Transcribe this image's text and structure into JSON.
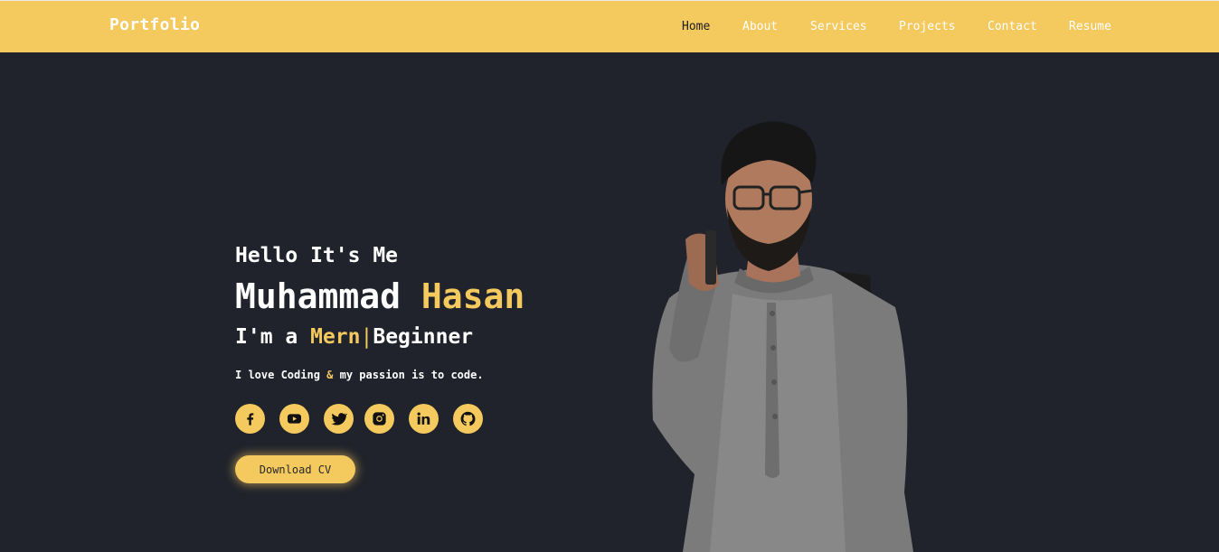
{
  "brand": {
    "logo": "Portfolio"
  },
  "nav": {
    "items": [
      {
        "label": "Home",
        "active": true
      },
      {
        "label": "About",
        "active": false
      },
      {
        "label": "Services",
        "active": false
      },
      {
        "label": "Projects",
        "active": false
      },
      {
        "label": "Contact",
        "active": false
      },
      {
        "label": "Resume",
        "active": false
      }
    ]
  },
  "hero": {
    "greeting": "Hello It's Me",
    "name_first": "Muhammad",
    "name_last": "Hasan",
    "role_prefix": "I'm a",
    "role_highlight": "Mern",
    "role_cursor": "|",
    "role_rest": "Beginner",
    "tagline_part1": "I love Coding",
    "tagline_amp": "&",
    "tagline_part2": "my passion is to code.",
    "socials": [
      {
        "icon": "facebook-icon"
      },
      {
        "icon": "youtube-icon"
      },
      {
        "icon": "twitter-icon"
      },
      {
        "icon": "instagram-icon"
      },
      {
        "icon": "linkedin-icon"
      },
      {
        "icon": "github-icon"
      }
    ],
    "cv_button": "Download CV"
  },
  "theme": {
    "accent": "#f4c95d",
    "background": "#20232c",
    "text": "#ffffff",
    "nav_active": "#1e1e1e"
  }
}
